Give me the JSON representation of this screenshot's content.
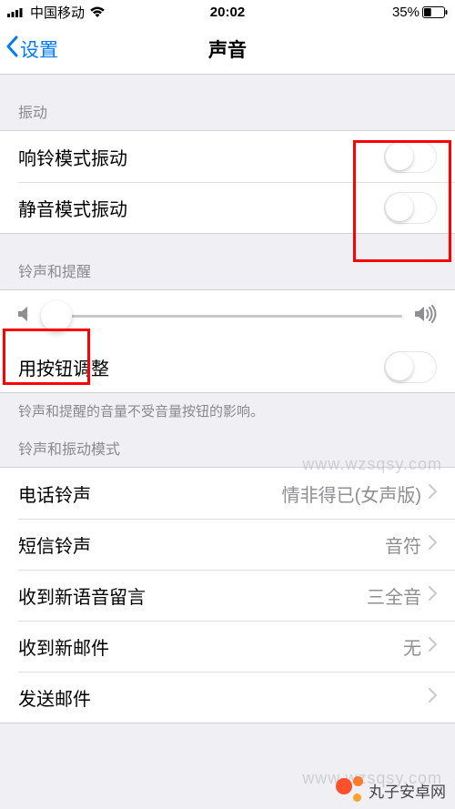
{
  "statusbar": {
    "carrier": "中国移动",
    "time": "20:02",
    "battery": "35%"
  },
  "nav": {
    "back": "设置",
    "title": "声音"
  },
  "sections": {
    "vibrate": {
      "header": "振动",
      "ring_vibrate": "响铃模式振动",
      "silent_vibrate": "静音模式振动"
    },
    "ringer": {
      "header": "铃声和提醒",
      "change_with_buttons": "用按钮调整",
      "footer": "铃声和提醒的音量不受音量按钮的影响。"
    },
    "patterns": {
      "header": "铃声和振动模式",
      "items": [
        {
          "label": "电话铃声",
          "value": "情非得已(女声版)"
        },
        {
          "label": "短信铃声",
          "value": "音符"
        },
        {
          "label": "收到新语音留言",
          "value": "三全音"
        },
        {
          "label": "收到新邮件",
          "value": "无"
        },
        {
          "label": "发送邮件",
          "value": ""
        }
      ]
    }
  },
  "watermark": {
    "url": "www.wzsqsy.com",
    "brand": "丸子安卓网"
  }
}
